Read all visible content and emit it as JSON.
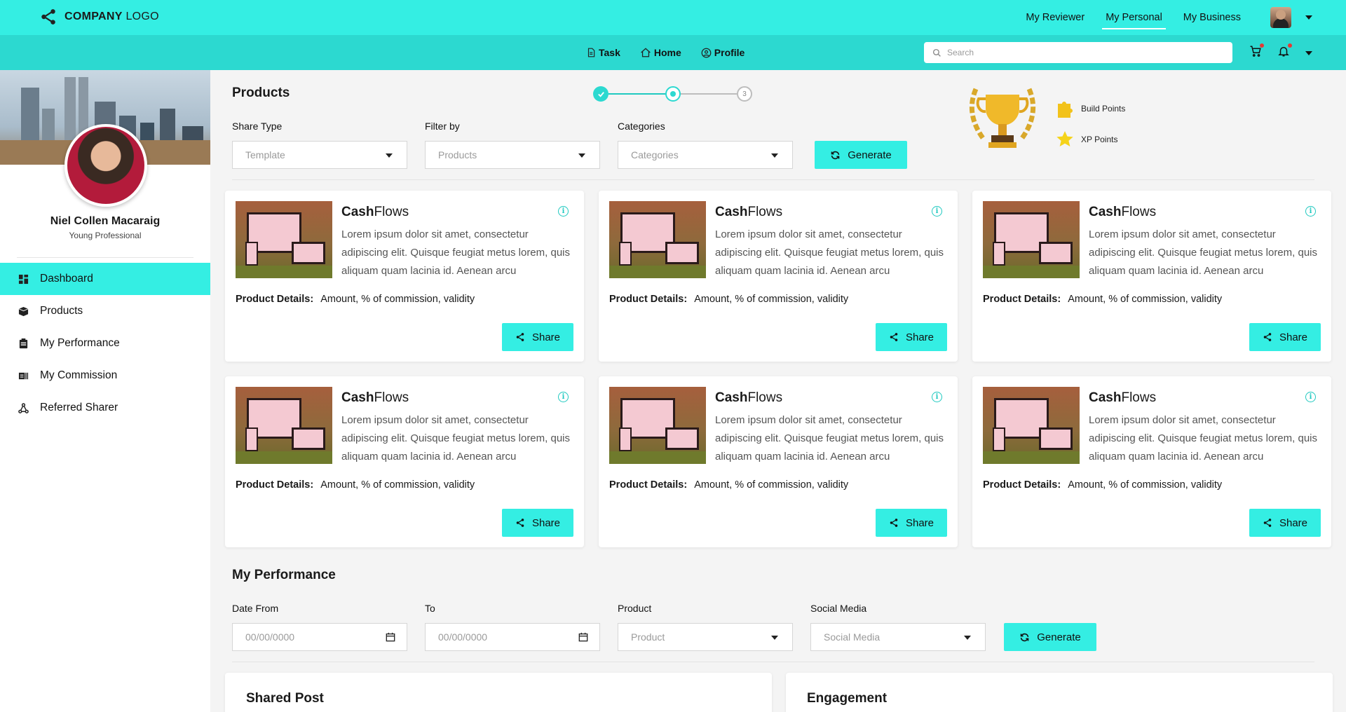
{
  "header": {
    "logo_bold": "COMPANY",
    "logo_thin": " LOGO",
    "nav": [
      "My Reviewer",
      "My Personal",
      "My Business"
    ],
    "active_nav": "My Personal"
  },
  "subnav": {
    "items": [
      {
        "label": "Task",
        "icon": "document-icon"
      },
      {
        "label": "Home",
        "icon": "home-icon"
      },
      {
        "label": "Profile",
        "icon": "user-circle-icon"
      }
    ],
    "search_placeholder": "Search"
  },
  "profile": {
    "name": "Niel Collen Macaraig",
    "role": "Young Professional"
  },
  "sidebar": {
    "items": [
      {
        "label": "Dashboard",
        "icon": "dashboard-icon",
        "active": true
      },
      {
        "label": "Products",
        "icon": "box-icon"
      },
      {
        "label": "My Performance",
        "icon": "performance-icon"
      },
      {
        "label": "My Commission",
        "icon": "commission-icon"
      },
      {
        "label": "Referred Sharer",
        "icon": "share-network-icon"
      }
    ]
  },
  "products": {
    "title": "Products",
    "stepper": {
      "current": 2,
      "third_label": "3"
    },
    "share_type_label": "Share Type",
    "share_type_placeholder": "Template",
    "filter_label": "Filter by",
    "filter_placeholder": "Products",
    "categories_label": "Categories",
    "categories_placeholder": "Categories",
    "generate_label": "Generate",
    "build_points_label": "Build Points",
    "xp_points_label": "XP Points"
  },
  "cards": [
    {
      "title_bold": "Cash",
      "title_rest": "Flows",
      "desc": "Lorem ipsum dolor sit amet, consectetur adipiscing elit. Quisque feugiat metus lorem, quis aliquam quam lacinia id. Aenean arcu",
      "details_label": "Product Details:",
      "details_value": "Amount, % of commission, validity",
      "share_label": "Share"
    },
    {
      "title_bold": "Cash",
      "title_rest": "Flows",
      "desc": "Lorem ipsum dolor sit amet, consectetur adipiscing elit. Quisque feugiat metus lorem, quis aliquam quam lacinia id. Aenean arcu",
      "details_label": "Product Details:",
      "details_value": "Amount, % of commission, validity",
      "share_label": "Share"
    },
    {
      "title_bold": "Cash",
      "title_rest": "Flows",
      "desc": "Lorem ipsum dolor sit amet, consectetur adipiscing elit. Quisque feugiat metus lorem, quis aliquam quam lacinia id. Aenean arcu",
      "details_label": "Product Details:",
      "details_value": "Amount, % of commission, validity",
      "share_label": "Share"
    },
    {
      "title_bold": "Cash",
      "title_rest": "Flows",
      "desc": "Lorem ipsum dolor sit amet, consectetur adipiscing elit. Quisque feugiat metus lorem, quis aliquam quam lacinia id. Aenean arcu",
      "details_label": "Product Details:",
      "details_value": "Amount, % of commission, validity",
      "share_label": "Share"
    },
    {
      "title_bold": "Cash",
      "title_rest": "Flows",
      "desc": "Lorem ipsum dolor sit amet, consectetur adipiscing elit. Quisque feugiat metus lorem, quis aliquam quam lacinia id. Aenean arcu",
      "details_label": "Product Details:",
      "details_value": "Amount, % of commission, validity",
      "share_label": "Share"
    },
    {
      "title_bold": "Cash",
      "title_rest": "Flows",
      "desc": "Lorem ipsum dolor sit amet, consectetur adipiscing elit. Quisque feugiat metus lorem, quis aliquam quam lacinia id. Aenean arcu",
      "details_label": "Product Details:",
      "details_value": "Amount, % of commission, validity",
      "share_label": "Share"
    }
  ],
  "performance": {
    "title": "My Performance",
    "date_from_label": "Date From",
    "date_from_placeholder": "00/00/0000",
    "to_label": "To",
    "to_placeholder": "00/00/0000",
    "product_label": "Product",
    "product_placeholder": "Product",
    "social_label": "Social Media",
    "social_placeholder": "Social Media",
    "generate_label": "Generate"
  },
  "bottom": {
    "shared_post": "Shared Post",
    "engagement": "Engagement"
  },
  "colors": {
    "accent": "#34eee3",
    "accent_dark": "#2cd9d0",
    "info": "#20c9c0"
  }
}
